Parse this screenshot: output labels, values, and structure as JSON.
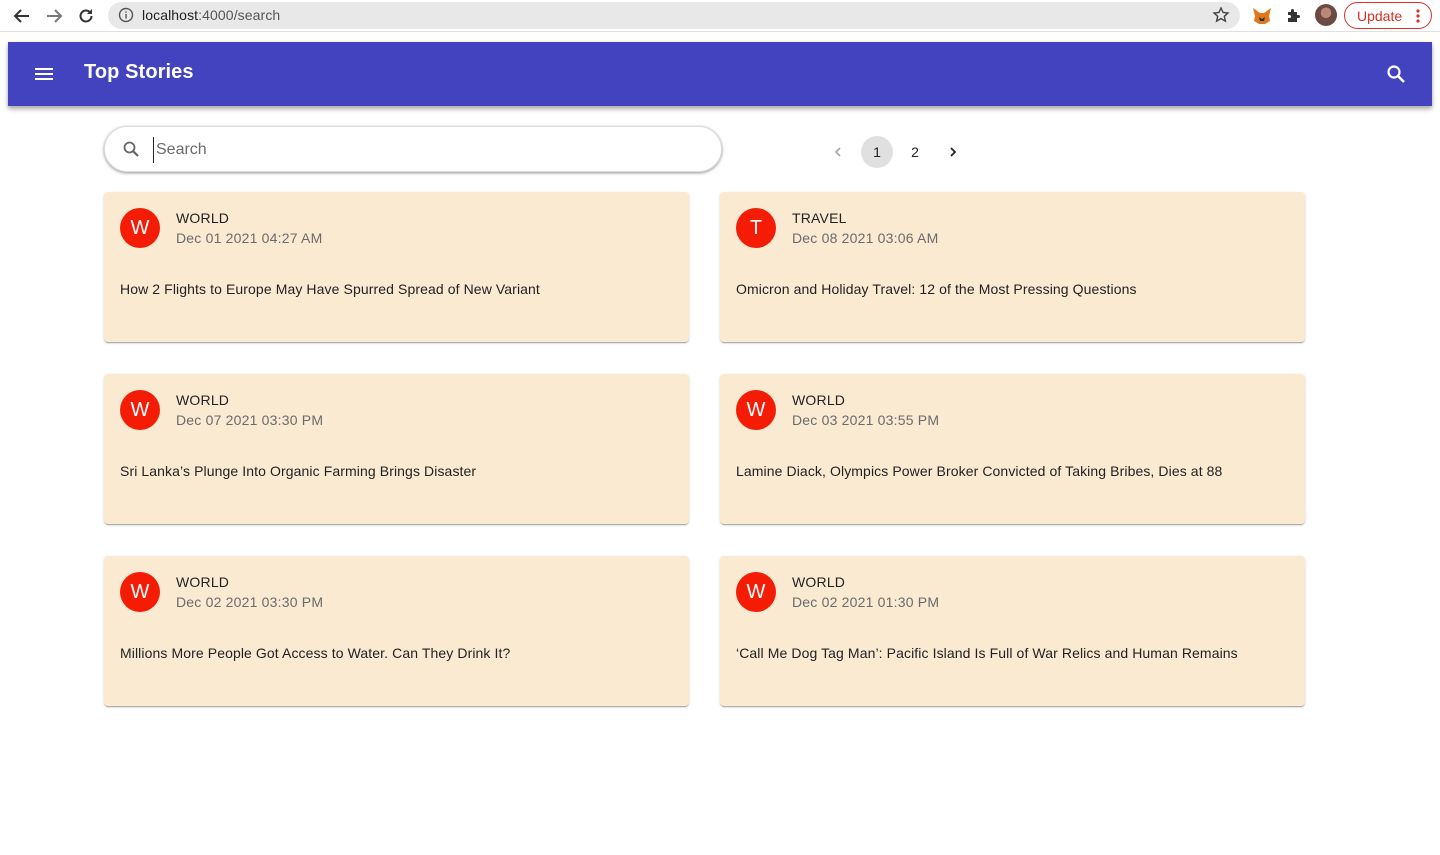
{
  "browser": {
    "url_host": "localhost",
    "url_path": ":4000/search",
    "update_label": "Update"
  },
  "app_bar": {
    "title": "Top Stories"
  },
  "search": {
    "placeholder": "Search",
    "value": ""
  },
  "pagination": {
    "pages": [
      "1",
      "2"
    ],
    "current": "1"
  },
  "stories": [
    {
      "avatar": "W",
      "category": "WORLD",
      "date": "Dec 01 2021 04:27 AM",
      "headline": "How 2 Flights to Europe May Have Spurred Spread of New Variant"
    },
    {
      "avatar": "T",
      "category": "TRAVEL",
      "date": "Dec 08 2021 03:06 AM",
      "headline": "Omicron and Holiday Travel: 12 of the Most Pressing Questions"
    },
    {
      "avatar": "W",
      "category": "WORLD",
      "date": "Dec 07 2021 03:30 PM",
      "headline": "Sri Lanka’s Plunge Into Organic Farming Brings Disaster"
    },
    {
      "avatar": "W",
      "category": "WORLD",
      "date": "Dec 03 2021 03:55 PM",
      "headline": "Lamine Diack, Olympics Power Broker Convicted of Taking Bribes, Dies at 88"
    },
    {
      "avatar": "W",
      "category": "WORLD",
      "date": "Dec 02 2021 03:30 PM",
      "headline": "Millions More People Got Access to Water. Can They Drink It?"
    },
    {
      "avatar": "W",
      "category": "WORLD",
      "date": "Dec 02 2021 01:30 PM",
      "headline": "‘Call Me Dog Tag Man’: Pacific Island Is Full of War Relics and Human Remains"
    }
  ],
  "colors": {
    "app_bar": "#4343bf",
    "card_background": "#fbead2",
    "avatar": "#f51c06"
  }
}
